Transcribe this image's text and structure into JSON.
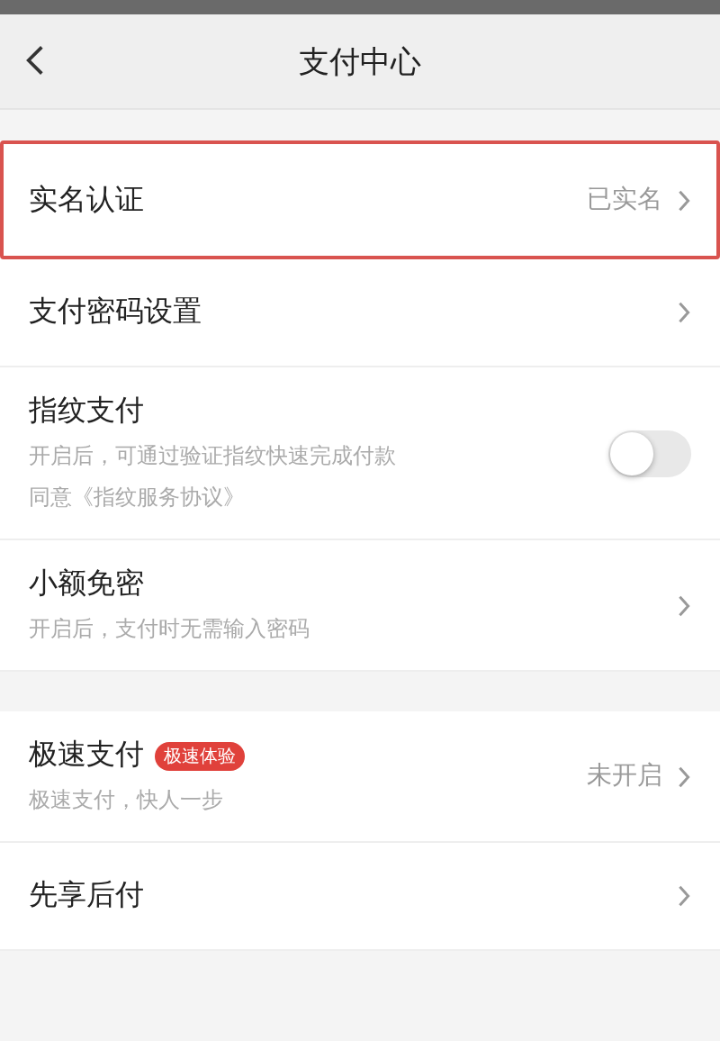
{
  "nav": {
    "title": "支付中心"
  },
  "sections": [
    {
      "items": [
        {
          "kind": "link",
          "title": "实名认证",
          "value": "已实名",
          "highlighted": true
        },
        {
          "kind": "link",
          "title": "支付密码设置",
          "highlighted": false
        },
        {
          "kind": "toggle",
          "title": "指纹支付",
          "subtitles": [
            "开启后，可通过验证指纹快速完成付款",
            "同意《指纹服务协议》"
          ],
          "on": false,
          "highlighted": false
        },
        {
          "kind": "link",
          "title": "小额免密",
          "subtitles": [
            "开启后，支付时无需输入密码"
          ],
          "highlighted": false
        }
      ]
    },
    {
      "items": [
        {
          "kind": "link",
          "title": "极速支付",
          "badge": "极速体验",
          "subtitles": [
            "极速支付，快人一步"
          ],
          "value": "未开启",
          "highlighted": false
        },
        {
          "kind": "link",
          "title": "先享后付",
          "highlighted": false
        }
      ]
    }
  ]
}
